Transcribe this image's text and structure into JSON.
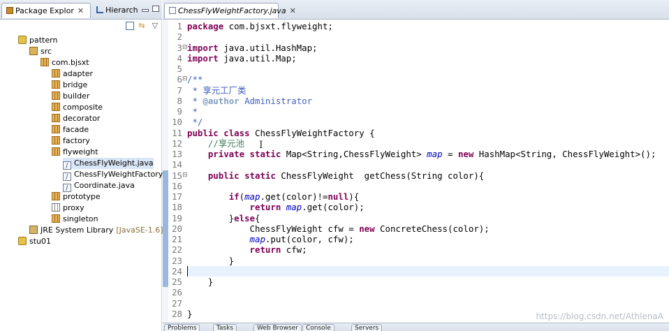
{
  "package_explorer": {
    "tab_label": "Package Explor",
    "close_glyph": "✕",
    "hierarchy_tab_label": "Hierarchy",
    "tree": [
      {
        "label": "pattern",
        "icon": "project-icon",
        "level": 0
      },
      {
        "label": "src",
        "icon": "source-folder-icon",
        "level": 1
      },
      {
        "label": "com.bjsxt",
        "icon": "package-icon",
        "level": 2
      },
      {
        "label": "adapter",
        "icon": "package-icon",
        "level": 3
      },
      {
        "label": "bridge",
        "icon": "package-icon",
        "level": 3
      },
      {
        "label": "builder",
        "icon": "package-icon",
        "level": 3
      },
      {
        "label": "composite",
        "icon": "package-icon",
        "level": 3
      },
      {
        "label": "decorator",
        "icon": "package-icon",
        "level": 3
      },
      {
        "label": "facade",
        "icon": "package-icon",
        "level": 3
      },
      {
        "label": "factory",
        "icon": "package-icon",
        "level": 3
      },
      {
        "label": "flyweight",
        "icon": "package-icon",
        "level": 3
      },
      {
        "label": "ChessFlyWeight.java",
        "icon": "java-file-icon",
        "level": 4,
        "selected": true
      },
      {
        "label": "ChessFlyWeightFactory.java",
        "icon": "java-file-icon",
        "level": 4
      },
      {
        "label": "Coordinate.java",
        "icon": "java-file-icon",
        "level": 4
      },
      {
        "label": "prototype",
        "icon": "package-icon",
        "level": 3
      },
      {
        "label": "proxy",
        "icon": "empty-package-icon",
        "level": 3
      },
      {
        "label": "singleton",
        "icon": "package-icon",
        "level": 3
      },
      {
        "label": "JRE System Library",
        "suffix": "[JavaSE-1.6]",
        "icon": "library-icon",
        "level": 1
      },
      {
        "label": "stu01",
        "icon": "project-icon",
        "level": 0
      }
    ]
  },
  "editor": {
    "tab_label": "ChessFlyWeightFactory.java",
    "close_glyph": "✕",
    "lines": [
      [
        [
          "kw",
          "package"
        ],
        [
          "t",
          " com.bjsxt.flyweight;"
        ]
      ],
      [],
      [
        [
          "kw",
          "import"
        ],
        [
          "t",
          " java.util.HashMap;"
        ]
      ],
      [
        [
          "kw",
          "import"
        ],
        [
          "t",
          " java.util.Map;"
        ]
      ],
      [],
      [
        [
          "cm",
          "/**"
        ]
      ],
      [
        [
          "cm",
          " * 享元工厂类"
        ]
      ],
      [
        [
          "cm",
          " * "
        ],
        [
          "tag",
          "@author"
        ],
        [
          "cm",
          " Administrator"
        ]
      ],
      [
        [
          "cm",
          " *"
        ]
      ],
      [
        [
          "cm",
          " */"
        ]
      ],
      [
        [
          "kw",
          "public"
        ],
        [
          "t",
          " "
        ],
        [
          "kw",
          "class"
        ],
        [
          "t",
          " ChessFlyWeightFactory {"
        ]
      ],
      [
        [
          "t",
          "    "
        ],
        [
          "cmt",
          "//享元池"
        ]
      ],
      [
        [
          "t",
          "    "
        ],
        [
          "kw",
          "private"
        ],
        [
          "t",
          " "
        ],
        [
          "kw",
          "static"
        ],
        [
          "t",
          " Map<String,ChessFlyWeight> "
        ],
        [
          "fld",
          "map"
        ],
        [
          "t",
          " = "
        ],
        [
          "kw",
          "new"
        ],
        [
          "t",
          " HashMap<String, ChessFlyWeight>();"
        ]
      ],
      [],
      [
        [
          "t",
          "    "
        ],
        [
          "kw",
          "public"
        ],
        [
          "t",
          " "
        ],
        [
          "kw",
          "static"
        ],
        [
          "t",
          " ChessFlyWeight  getChess(String color){"
        ]
      ],
      [],
      [
        [
          "t",
          "        "
        ],
        [
          "kw",
          "if"
        ],
        [
          "t",
          "("
        ],
        [
          "fld",
          "map"
        ],
        [
          "t",
          ".get(color)!="
        ],
        [
          "kw",
          "null"
        ],
        [
          "t",
          "){"
        ]
      ],
      [
        [
          "t",
          "            "
        ],
        [
          "kw",
          "return"
        ],
        [
          "t",
          " "
        ],
        [
          "fld",
          "map"
        ],
        [
          "t",
          ".get(color);"
        ]
      ],
      [
        [
          "t",
          "        }"
        ],
        [
          "kw",
          "else"
        ],
        [
          "t",
          "{"
        ]
      ],
      [
        [
          "t",
          "            ChessFlyWeight cfw = "
        ],
        [
          "kw",
          "new"
        ],
        [
          "t",
          " ConcreteChess(color);"
        ]
      ],
      [
        [
          "t",
          "            "
        ],
        [
          "fld",
          "map"
        ],
        [
          "t",
          ".put(color, cfw);"
        ]
      ],
      [
        [
          "t",
          "            "
        ],
        [
          "kw",
          "return"
        ],
        [
          "t",
          " cfw;"
        ]
      ],
      [
        [
          "t",
          "        }"
        ]
      ],
      [],
      [
        [
          "t",
          "    }"
        ]
      ],
      [],
      [],
      [
        [
          "t",
          "}"
        ]
      ]
    ],
    "fold_markers": {
      "3": "⊟",
      "6": "⊟",
      "15": "⊟"
    },
    "current_line": 24
  },
  "bottom_tabs": [
    "Problems",
    "Tasks",
    "Web Browser",
    "Console",
    "Servers"
  ],
  "watermark": "https://blog.csdn.net/AthlenaA"
}
